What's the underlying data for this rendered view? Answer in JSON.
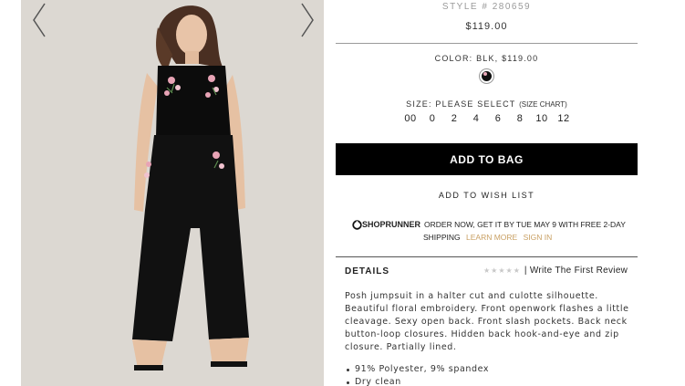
{
  "gallery": {
    "image_icon": "model-in-black-jumpsuit-image",
    "prev_icon": "chevron-left-icon",
    "next_icon": "chevron-right-icon",
    "background": "#dcd8d2"
  },
  "product": {
    "style_number": "STYLE # 280659",
    "price": "$119.00",
    "color_label": "COLOR: BLK, $119.00",
    "swatch_icon": "black-floral-swatch",
    "size_prompt": "SIZE: PLEASE SELECT",
    "size_chart": "(SIZE CHART)",
    "sizes": [
      "00",
      "0",
      "2",
      "4",
      "6",
      "8",
      "10",
      "12"
    ],
    "add_to_bag": "ADD TO BAG",
    "add_to_wish_list": "ADD TO WISH LIST"
  },
  "shoprunner": {
    "logo_icon": "shoprunner-logo-icon",
    "logo_text": "SHOPRUNNER",
    "message": "ORDER NOW, GET IT BY TUE MAY 9 WITH FREE 2-DAY",
    "message_cont": "SHIPPING",
    "learn_more": "LEARN MORE",
    "sign_in": "SIGN IN",
    "link_color": "#c9a063"
  },
  "details": {
    "heading": "DETAILS",
    "stars": "★★★★★",
    "rating_value": 0,
    "review_link": "| Write The First Review",
    "description": "Posh jumpsuit in a halter cut and culotte silhouette. Beautiful floral embroidery. Front openwork flashes a little cleavage. Sexy open back. Front slash pockets. Back neck button-loop closures. Hidden back hook-and-eye and zip closure. Partially lined.",
    "bullets": [
      "91% Polyester, 9% spandex",
      "Dry clean"
    ]
  }
}
